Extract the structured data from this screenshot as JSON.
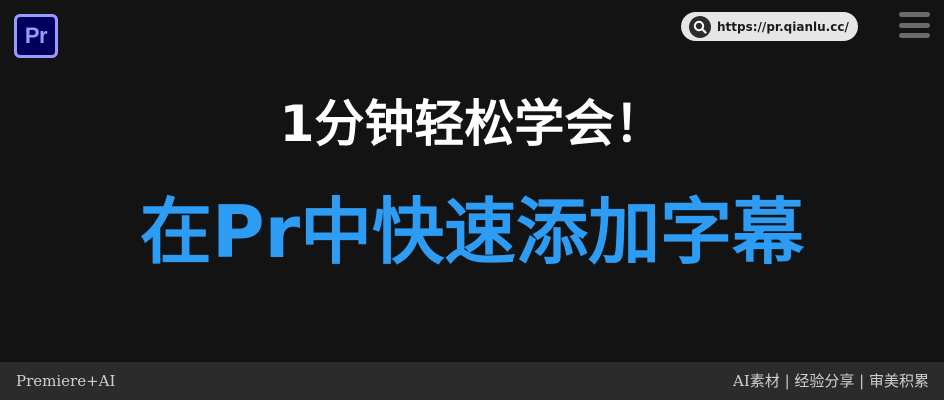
{
  "logo": {
    "text": "Pr"
  },
  "header": {
    "url": "https://pr.qianlu.cc/"
  },
  "hero": {
    "headline": "1分钟轻松学会！",
    "title": "在Pr中快速添加字幕"
  },
  "footer": {
    "left_text": "Premiere+AI",
    "right_text": "AI素材 | 经验分享 | 审美积累"
  },
  "icons": {
    "search": "search-icon",
    "menu": "menu-icon"
  },
  "colors": {
    "background": "#131313",
    "title_blue": "#2d9cf5",
    "logo_bg": "#00005b",
    "logo_accent": "#9999ff",
    "footer_bg": "#2b2b2b"
  }
}
